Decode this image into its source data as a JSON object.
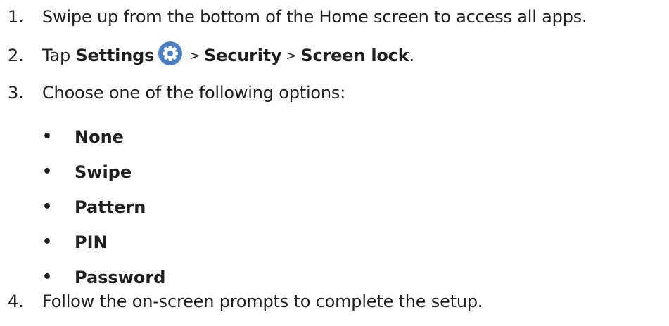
{
  "steps": [
    {
      "number": "1.",
      "text": "Swipe up from the bottom of the Home screen to access all apps."
    },
    {
      "number": "2.",
      "prefix": "Tap ",
      "settings_label": "Settings",
      "separator_1": ">",
      "security_label": "Security",
      "separator_2": ">",
      "screen_lock_label": "Screen lock",
      "suffix": "."
    },
    {
      "number": "3.",
      "text": "Choose one of the following options:"
    },
    {
      "number": "4.",
      "text": "Follow the on-screen prompts to complete the setup."
    }
  ],
  "options": [
    {
      "bullet": "•",
      "label": "None"
    },
    {
      "bullet": "•",
      "label": "Swipe"
    },
    {
      "bullet": "•",
      "label": "Pattern"
    },
    {
      "bullet": "•",
      "label": "PIN"
    },
    {
      "bullet": "•",
      "label": "Password"
    }
  ],
  "icons": {
    "settings": "gear-icon"
  },
  "colors": {
    "text": "#1f1f1f",
    "settings_icon_bg": "#4a7fc6",
    "settings_icon_fg": "#ffffff"
  }
}
